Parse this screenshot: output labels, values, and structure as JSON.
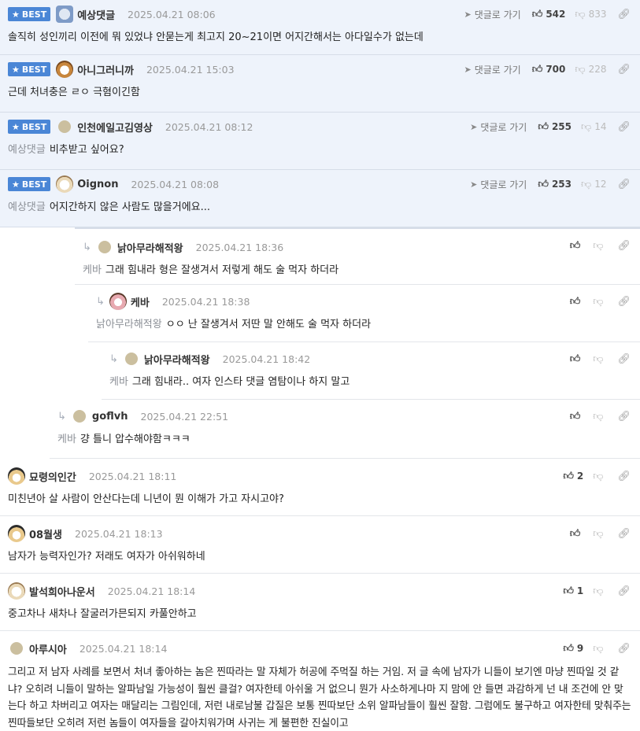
{
  "labels": {
    "best": "BEST",
    "goto": "댓글로 가기"
  },
  "colors": {
    "best_bg": "#eef3fb",
    "badge": "#4a86d6"
  },
  "best_comments": [
    {
      "nick": "예상댓글",
      "date": "2025.04.21 08:06",
      "up": "542",
      "down": "833",
      "ref": "",
      "text": "솔직히 성인끼리 이전에 뭐 있었냐 안묻는게 최고지 20~21이면 어지간해서는 아다일수가 없는데",
      "avatar": "blue-icon"
    },
    {
      "nick": "아니그러니까",
      "date": "2025.04.21 15:03",
      "up": "700",
      "down": "228",
      "ref": "",
      "text": "근데 처녀충은 ㄹㅇ 극혐이긴함",
      "avatar": "dog-icon"
    },
    {
      "nick": "인천에일고김영상",
      "date": "2025.04.21 08:12",
      "up": "255",
      "down": "14",
      "ref": "예상댓글",
      "text": "비추받고 싶어요?",
      "avatar": "dot-icon"
    },
    {
      "nick": "Oignon",
      "date": "2025.04.21 08:08",
      "up": "253",
      "down": "12",
      "ref": "예상댓글",
      "text": "어지간하지 않은 사람도 많을거에요...",
      "avatar": "pup-icon"
    }
  ],
  "replies": [
    {
      "nick": "낡아무라해적왕",
      "date": "2025.04.21 18:36",
      "ref": "케바",
      "text": "그래 힘내라 형은 잘생겨서 저렇게 해도 술 먹자 하더라"
    },
    {
      "nick": "케바",
      "date": "2025.04.21 18:38",
      "ref": "낡아무라해적왕",
      "text": "ㅇㅇ 난 잘생겨서 저딴 말 안해도 술 먹자 하더라"
    },
    {
      "nick": "낡아무라해적왕",
      "date": "2025.04.21 18:42",
      "ref": "케바",
      "text": "그래 힘내라.. 여자 인스타 댓글 염탐이나 하지 말고"
    },
    {
      "nick": "goflvh",
      "date": "2025.04.21 22:51",
      "ref": "케바",
      "text": "걍 틀니 압수해야함ㅋㅋㅋ"
    }
  ],
  "comments": [
    {
      "nick": "묘령의인간",
      "date": "2025.04.21 18:11",
      "up": "2",
      "text": "미친년아 살 사람이 안산다는데 니년이 뭔 이해가 가고 자시고야?"
    },
    {
      "nick": "08월생",
      "date": "2025.04.21 18:13",
      "up": "",
      "text": "남자가 능력자인가? 저래도 여자가 아쉬워하네"
    },
    {
      "nick": "발석희아나운서",
      "date": "2025.04.21 18:14",
      "up": "1",
      "text": "중고차나 새차나 잘굴러가믄되지 카풀안하고"
    },
    {
      "nick": "아루시아",
      "date": "2025.04.21 18:14",
      "up": "9",
      "text": "그리고 저 남자 사례를 보면서 처녀 좋아하는 놈은 찐따라는 말 자체가 허공에 주먹질 하는 거임. 저 글 속에 남자가 니들이 보기엔 마냥 찐따일 것 같냐? 오히려 니들이 말하는 알파남일 가능성이 훨씬 클걸? 여자한테 아쉬울 거 없으니 뭔가 사소하게나마 지 맘에 안 들면 과감하게 넌 내 조건에 안 맞는다 하고 차버리고 여자는 매달리는 그림인데, 저런 내로남불 갑질은 보통 찐따보단 소위 알파남들이 훨씬 잘함. 그럼에도 불구하고 여자한테 맞춰주는 찐따들보단 오히려 저런 놈들이 여자들을 갈아치워가며 사귀는 게 불편한 진실이고"
    }
  ]
}
